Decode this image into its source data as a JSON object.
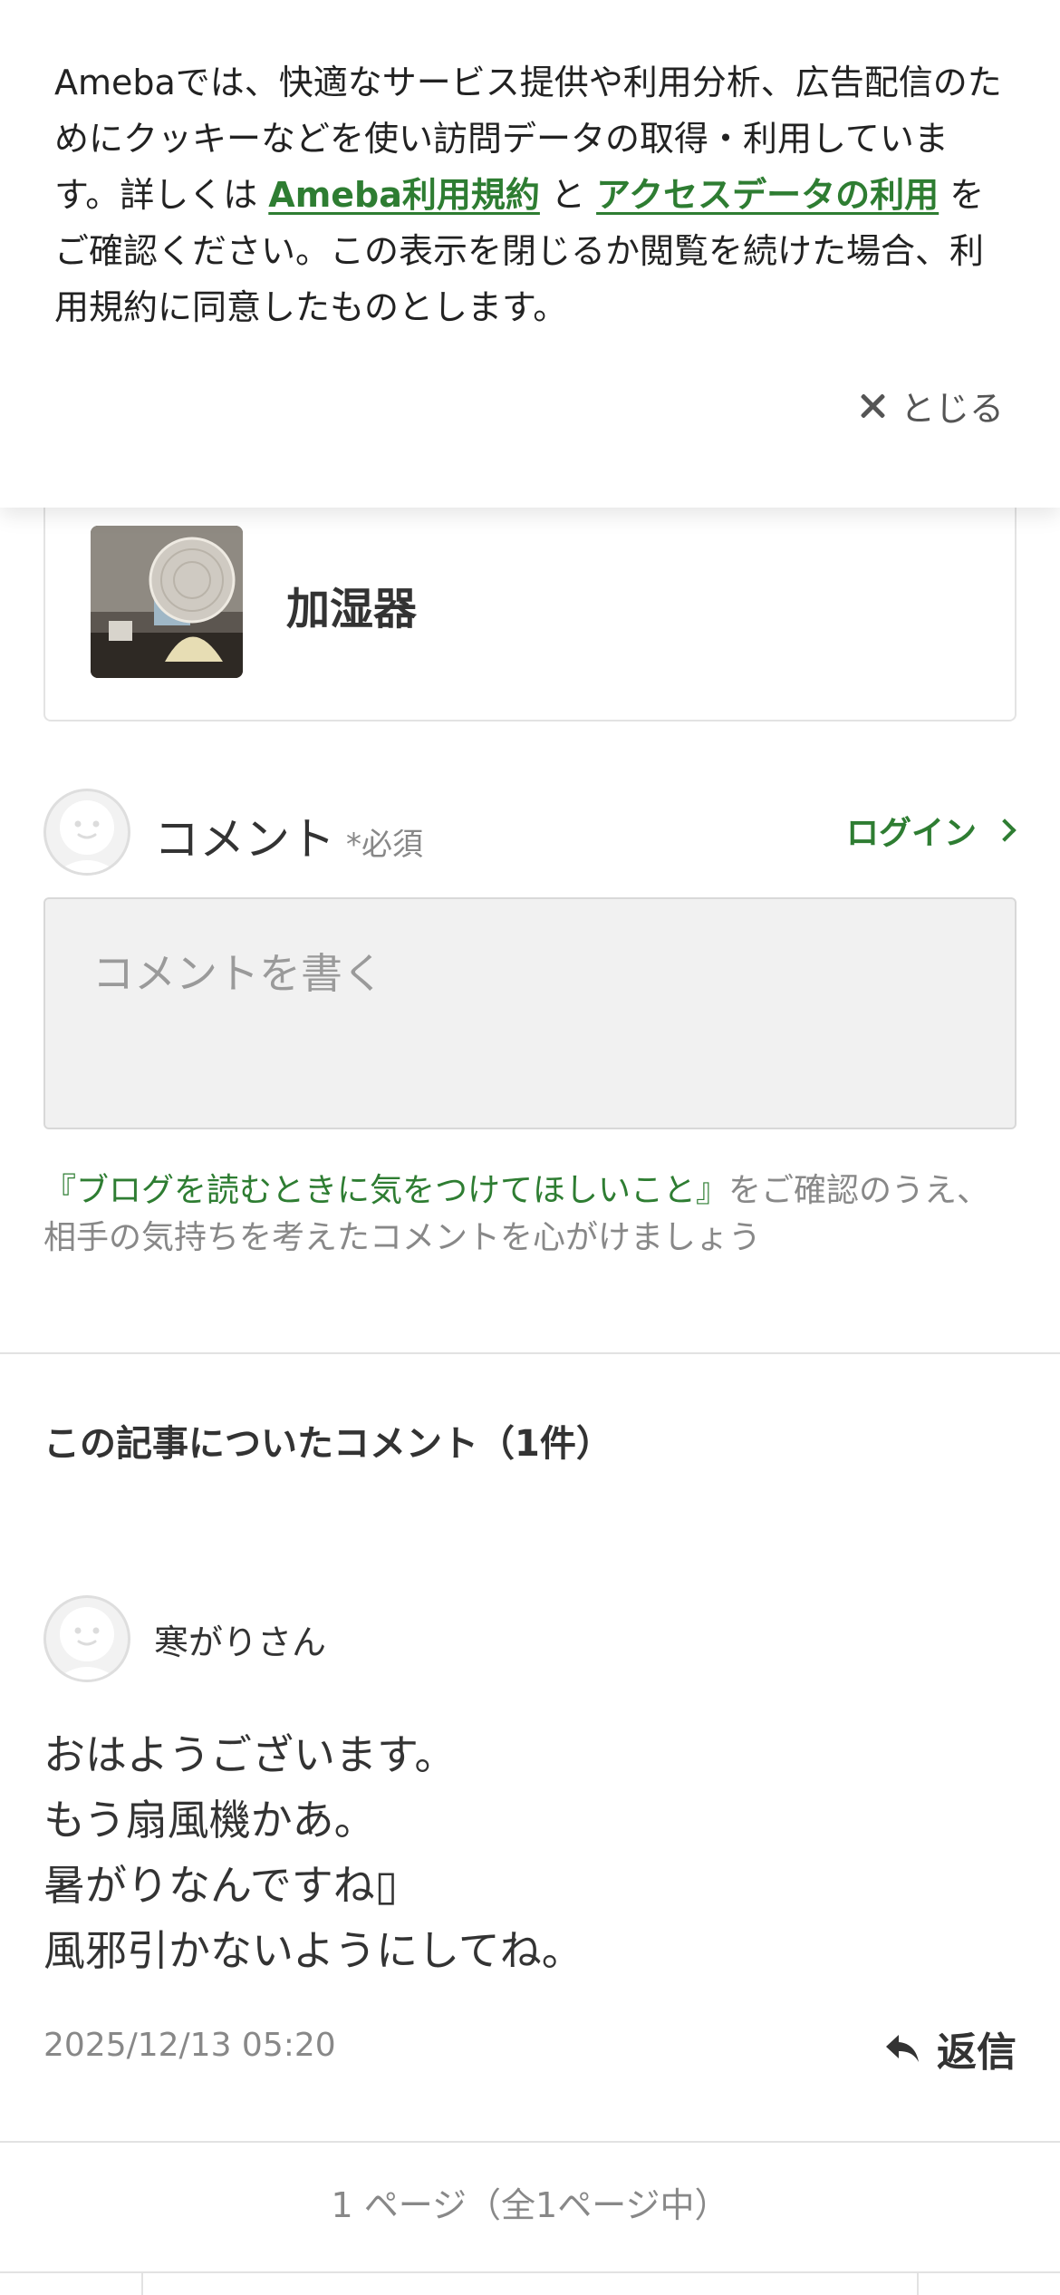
{
  "cookie_banner": {
    "text_before": "Amebaでは、快適なサービス提供や利用分析、広告配信のためにクッキーなどを使い訪問データの取得・利用しています。詳しくは ",
    "link_terms": "Ameba利用規約",
    "text_and": " と ",
    "link_access_data": "アクセスデータの利用",
    "text_after": " をご確認ください。この表示を閉じるか閲覧を続けた場合、利用規約に同意したものとします。",
    "close_label": "とじる"
  },
  "article_card": {
    "title": "加湿器"
  },
  "comment_form": {
    "label": "コメント",
    "required": "*必須",
    "login": "ログイン",
    "placeholder": "コメントを書く",
    "notice_link": "『ブログを読むときに気をつけてほしいこと』",
    "notice_text": "をご確認のうえ、相手の気持ちを考えたコメントを心がけましょう"
  },
  "comments": {
    "heading": "この記事についたコメント（1件）",
    "items": [
      {
        "author": "寒がりさん",
        "lines": [
          "おはようございます。",
          "もう扇風機かあ。",
          "暑がりなんですね▯",
          "風邪引かないようにしてね。"
        ],
        "date": "2025/12/13 05:20",
        "reply": "返信"
      }
    ]
  },
  "pagination": {
    "info": "1 ページ（全1ページ中）"
  },
  "colors": {
    "accent": "#2e7d32",
    "text": "#333333",
    "muted": "#888888"
  }
}
